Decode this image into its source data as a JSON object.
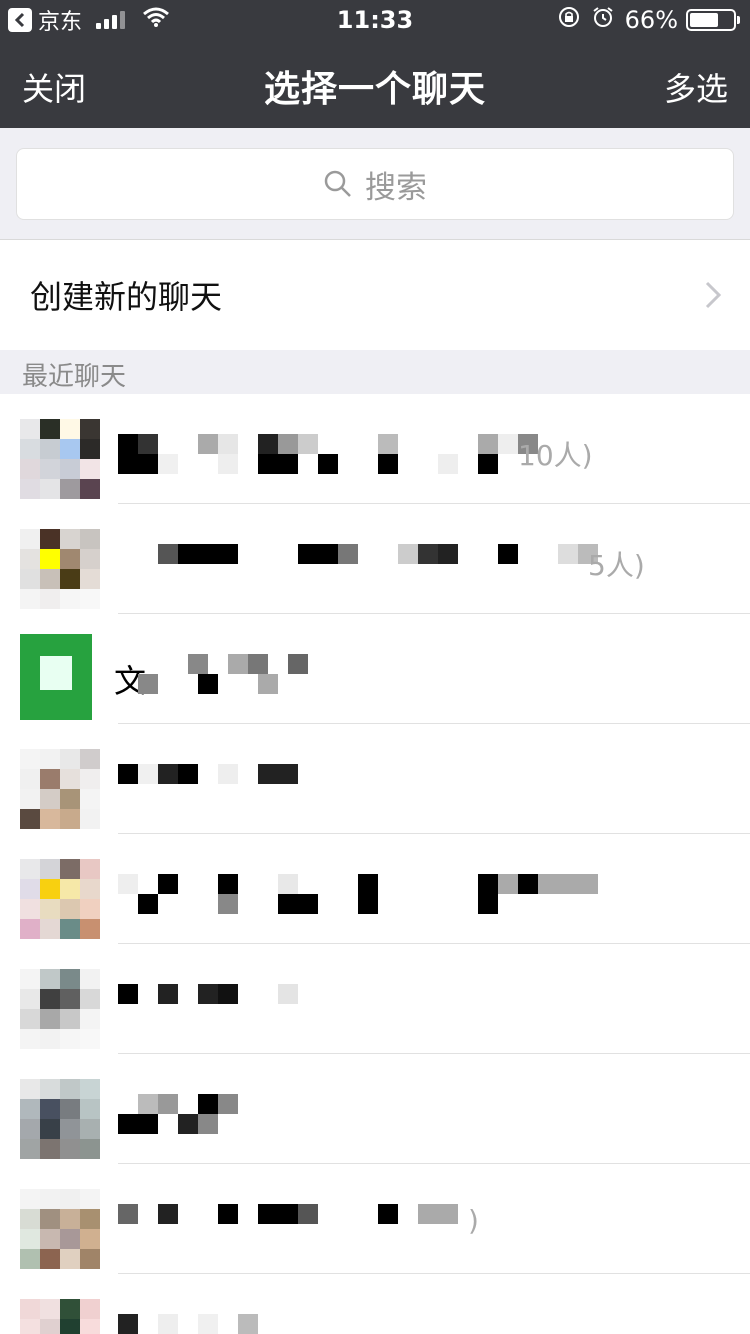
{
  "status_bar": {
    "back_app": "京东",
    "time": "11:33",
    "battery_percent": "66%",
    "battery_level": 0.66
  },
  "nav": {
    "left": "关闭",
    "title": "选择一个聊天",
    "right": "多选"
  },
  "search": {
    "placeholder": "搜索"
  },
  "create_chat": {
    "label": "创建新的聊天"
  },
  "recent": {
    "header": "最近聊天",
    "chats": [
      {
        "name": "",
        "suffix": "10人)"
      },
      {
        "name": "",
        "suffix": "5人)"
      },
      {
        "name": "文",
        "suffix": ""
      },
      {
        "name": "",
        "suffix": ""
      },
      {
        "name": "",
        "suffix": ""
      },
      {
        "name": "",
        "suffix": ""
      },
      {
        "name": "",
        "suffix": ""
      },
      {
        "name": "",
        "suffix": ")"
      },
      {
        "name": "",
        "suffix": ""
      }
    ]
  },
  "colors": {
    "nav_bg": "#393a3f",
    "page_bg": "#efeff4",
    "file_helper_green": "#27a23f"
  }
}
